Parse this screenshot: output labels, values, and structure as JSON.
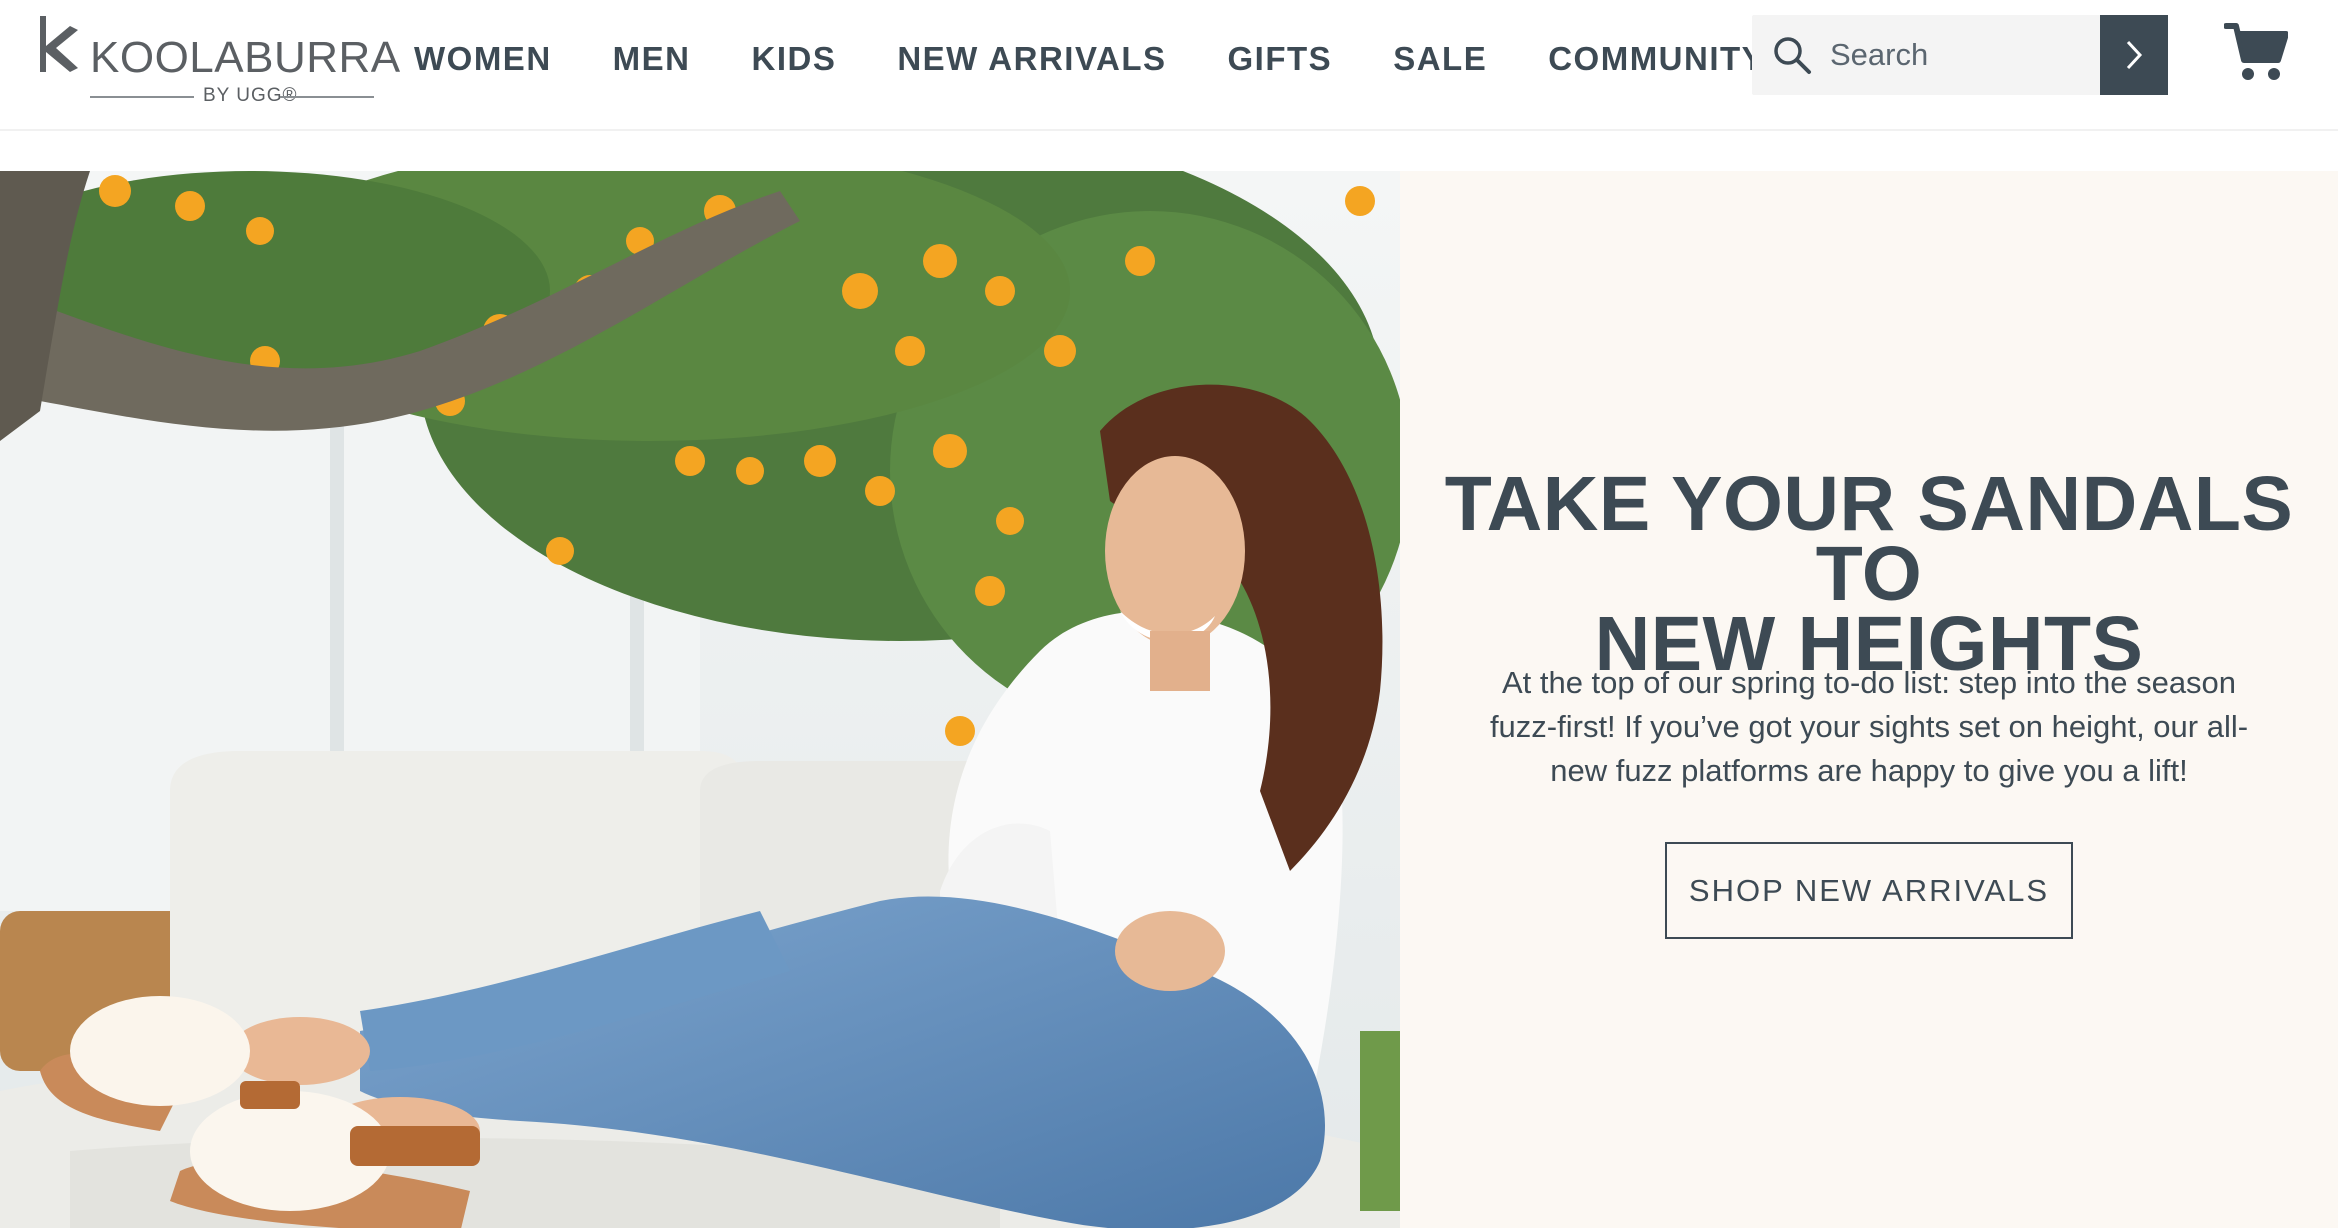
{
  "brand": {
    "name": "KOOLABURRA",
    "sub": "BY UGG®"
  },
  "nav": {
    "items": [
      {
        "label": "WOMEN"
      },
      {
        "label": "MEN"
      },
      {
        "label": "KIDS"
      },
      {
        "label": "NEW ARRIVALS"
      },
      {
        "label": "GIFTS"
      },
      {
        "label": "SALE"
      },
      {
        "label": "COMMUNITY"
      }
    ]
  },
  "search": {
    "placeholder": "Search",
    "icon": "search-icon",
    "submit_icon": "chevron-right-icon"
  },
  "cart": {
    "icon": "shopping-cart-icon"
  },
  "hero": {
    "headline_line1": "TAKE YOUR SANDALS TO",
    "headline_line2": "NEW HEIGHTS",
    "body": "At the top of our spring to-do list: step into the season fuzz-first! If you’ve got your sights set on height, our all-new fuzz platforms are happy to give you a lift!",
    "cta_label": "SHOP NEW ARRIVALS"
  },
  "colors": {
    "primary_text": "#3d4a54",
    "panel_bg": "#fcf8f3",
    "search_bg": "#f4f4f4",
    "button_dark": "#3d4a54"
  }
}
